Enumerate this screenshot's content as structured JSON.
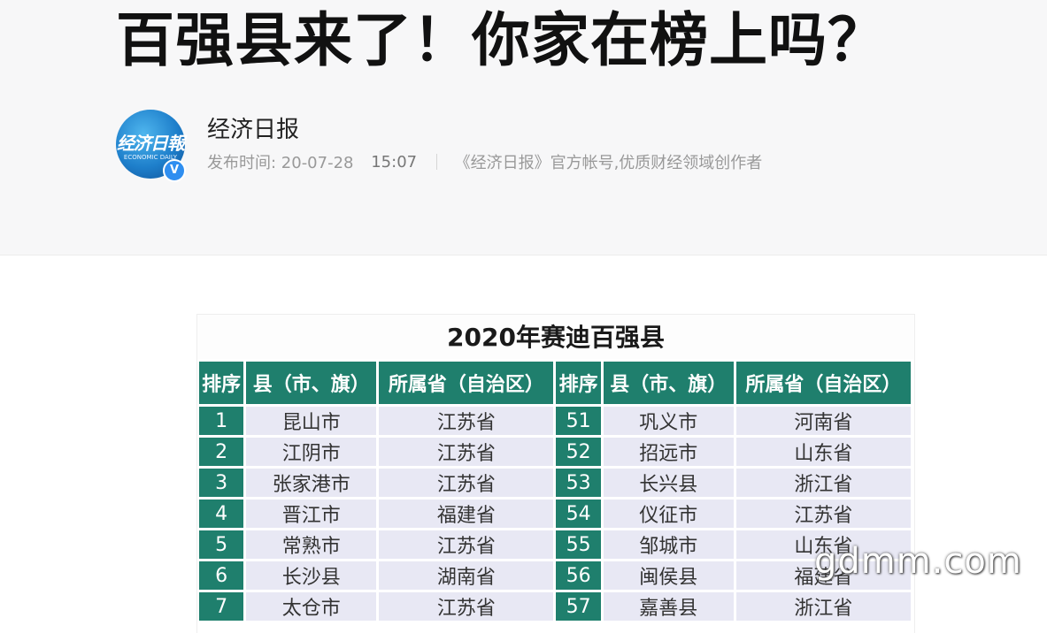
{
  "article": {
    "title": "百强县来了！你家在榜上吗？"
  },
  "author": {
    "name": "经济日报",
    "avatar_logo": "经济日報",
    "avatar_sub": "ECONOMIC DAILY",
    "verified_glyph": "V",
    "publish_label": "发布时间: 20-07-28",
    "publish_time": "15:07",
    "description": "《经济日报》官方帐号,优质财经领域创作者"
  },
  "figure": {
    "title": "2020年赛迪百强县",
    "headers": [
      "排序",
      "县（市、旗）",
      "所属省（自治区）",
      "排序",
      "县（市、旗）",
      "所属省（自治区）"
    ],
    "rows": [
      [
        "1",
        "昆山市",
        "江苏省",
        "51",
        "巩义市",
        "河南省"
      ],
      [
        "2",
        "江阴市",
        "江苏省",
        "52",
        "招远市",
        "山东省"
      ],
      [
        "3",
        "张家港市",
        "江苏省",
        "53",
        "长兴县",
        "浙江省"
      ],
      [
        "4",
        "晋江市",
        "福建省",
        "54",
        "仪征市",
        "江苏省"
      ],
      [
        "5",
        "常熟市",
        "江苏省",
        "55",
        "邹城市",
        "山东省"
      ],
      [
        "6",
        "长沙县",
        "湖南省",
        "56",
        "闽侯县",
        "福建省"
      ],
      [
        "7",
        "太仓市",
        "江苏省",
        "57",
        "嘉善县",
        "浙江省"
      ]
    ]
  },
  "watermark": "gdmm.com",
  "colors": {
    "header_bg": "#f7f7f8",
    "table_header": "#1f7f6d",
    "table_cell": "#e8e8f4",
    "verified": "#2f8ef0"
  },
  "icons": {
    "verified": "verified-badge-icon"
  }
}
